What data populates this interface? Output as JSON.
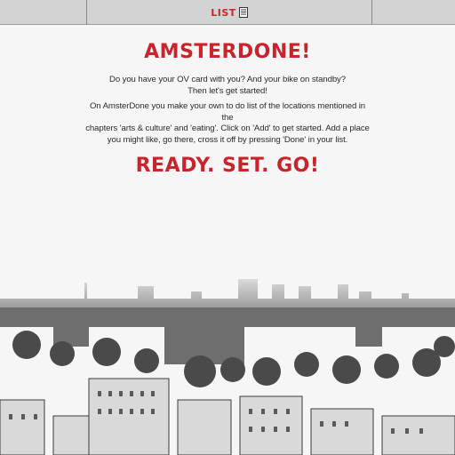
{
  "nav": {
    "list_label": "LIST",
    "list_icon": "document-list-icon",
    "accent": "#d1242a"
  },
  "content": {
    "title": "AMSTERDONE!",
    "intro_line1": "Do you have your OV card with you? And your bike on standby?",
    "intro_line2": "Then let's get started!",
    "body_line1": "On AmsterDone you make your own to do list of the locations mentioned in the",
    "body_line2": "chapters 'arts & culture' and 'eating'. Click on 'Add' to get started. Add a place",
    "body_line3": "you might like, go there, cross it off by pressing 'Done' in your list.",
    "cta": "READY. SET. GO!"
  },
  "background": {
    "image": "amsterdam-skyline-photo",
    "tone": "#f6f6f6"
  }
}
